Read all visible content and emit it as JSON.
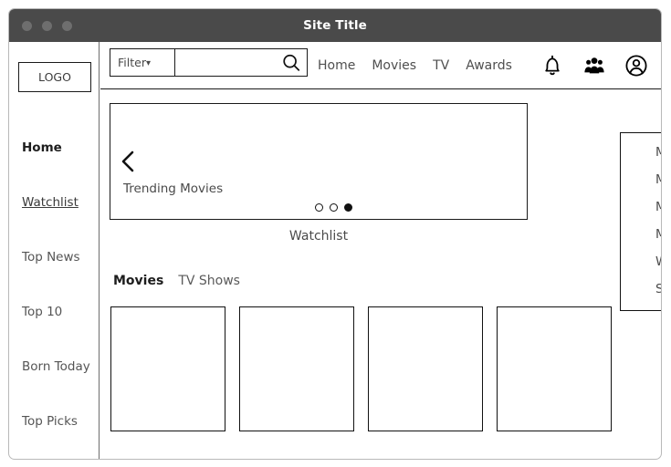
{
  "window": {
    "title": "Site Title",
    "controls": [
      "close-dot",
      "minimize-dot",
      "maximize-dot"
    ],
    "titlebar_color": "#4a4a4a"
  },
  "sidebar": {
    "logo": "LOGO",
    "items": [
      {
        "label": "Home",
        "state": "active-bold"
      },
      {
        "label": "Watchlist",
        "state": "underlined"
      },
      {
        "label": "Top News",
        "state": "normal"
      },
      {
        "label": "Top 10",
        "state": "normal"
      },
      {
        "label": "Born Today",
        "state": "normal"
      },
      {
        "label": "Top Picks",
        "state": "normal"
      }
    ]
  },
  "toolbar": {
    "filter_label": "Filter",
    "filter_chevron": "chevron-down-icon",
    "search": {
      "value": "",
      "placeholder": ""
    },
    "search_icon": "search-icon",
    "nav_links": [
      {
        "label": "Home"
      },
      {
        "label": "Movies"
      },
      {
        "label": "TV"
      },
      {
        "label": "Awards"
      }
    ],
    "icons": [
      {
        "name": "bell-icon"
      },
      {
        "name": "people-group-icon"
      },
      {
        "name": "account-avatar-icon"
      }
    ]
  },
  "carousel": {
    "prev_icon": "chevron-left-icon",
    "label": "Trending Movies",
    "dots": [
      {
        "active": false
      },
      {
        "active": false
      },
      {
        "active": true
      }
    ]
  },
  "watchlist": {
    "section_title": "Watchlist",
    "tabs": [
      {
        "label": "Movies",
        "active": true
      },
      {
        "label": "TV Shows",
        "active": false
      }
    ],
    "cards": [
      {
        "label": ""
      },
      {
        "label": ""
      },
      {
        "label": ""
      },
      {
        "label": ""
      }
    ]
  },
  "account_menu": {
    "items": [
      {
        "label": "My Account"
      },
      {
        "label": "My Ratings"
      },
      {
        "label": "My Reviews"
      },
      {
        "label": "My Lists"
      },
      {
        "label": "Watchlist"
      },
      {
        "label": "Settings"
      }
    ]
  }
}
